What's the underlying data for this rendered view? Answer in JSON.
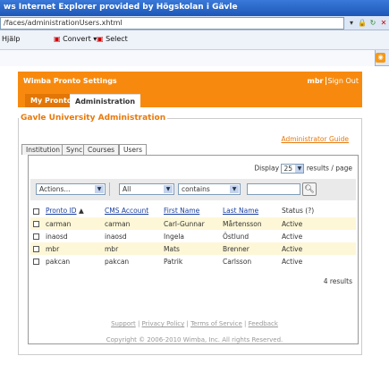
{
  "browser": {
    "title": "ws Internet Explorer provided by Högskolan i Gävle",
    "address": "/faces/administrationUsers.xhtml",
    "menu": {
      "help": "Hjälp",
      "convert": "Convert",
      "select": "Select"
    }
  },
  "header": {
    "app_title": "Wimba Pronto Settings",
    "user": "mbr",
    "sign_out": "Sign Out",
    "tabs": [
      "My Pronto",
      "Administration"
    ]
  },
  "admin": {
    "title": "Gavle University Administration",
    "guide_link": "Administrator Guide",
    "subtabs": [
      "Institution",
      "Sync",
      "Courses",
      "Users"
    ],
    "display_label": "Display",
    "display_value": "25",
    "display_suffix": "results / page",
    "actions_label": "Actions...",
    "filter_scope": "All",
    "filter_op": "contains",
    "columns": [
      "Pronto ID",
      "CMS Account",
      "First Name",
      "Last Name",
      "Status (?)"
    ],
    "rows": [
      [
        "carman",
        "carman",
        "Carl-Gunnar",
        "Mårtensson",
        "Active"
      ],
      [
        "inaosd",
        "inaosd",
        "Ingela",
        "Östlund",
        "Active"
      ],
      [
        "mbr",
        "mbr",
        "Mats",
        "Brenner",
        "Active"
      ],
      [
        "pakcan",
        "pakcan",
        "Patrik",
        "Carlsson",
        "Active"
      ]
    ],
    "results_text": "4 results"
  },
  "footer": {
    "links": [
      "Support",
      "Privacy Policy",
      "Terms of Service",
      "Feedback"
    ],
    "copyright": "Copyright © 2006-2010 Wimba, Inc. All rights Reserved."
  }
}
